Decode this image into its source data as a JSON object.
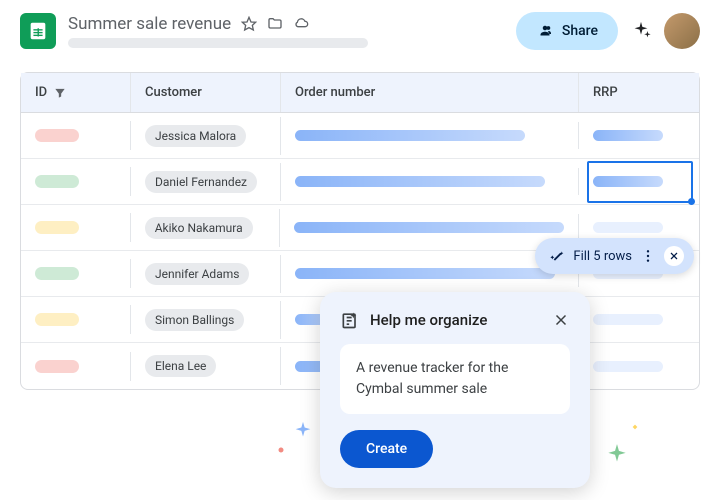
{
  "header": {
    "doc_title": "Summer sale revenue",
    "share_label": "Share"
  },
  "columns": {
    "id": "ID",
    "customer": "Customer",
    "order": "Order number",
    "rrp": "RRP"
  },
  "rows": [
    {
      "customer": "Jessica Malora",
      "id_color": "pill-red",
      "order_w": 230,
      "rrp_w": 70,
      "rrp_style": "blue"
    },
    {
      "customer": "Daniel Fernandez",
      "id_color": "pill-green",
      "order_w": 250,
      "rrp_w": 70,
      "rrp_style": "blue"
    },
    {
      "customer": "Akiko Nakamura",
      "id_color": "pill-yellow",
      "order_w": 270,
      "rrp_w": 70,
      "rrp_style": "light"
    },
    {
      "customer": "Jennifer Adams",
      "id_color": "pill-green",
      "order_w": 260,
      "rrp_w": 70,
      "rrp_style": "light"
    },
    {
      "customer": "Simon Ballings",
      "id_color": "pill-yellow",
      "order_w": 40,
      "rrp_w": 70,
      "rrp_style": "light"
    },
    {
      "customer": "Elena Lee",
      "id_color": "pill-red",
      "order_w": 110,
      "rrp_w": 70,
      "rrp_style": "light"
    }
  ],
  "fill_chip": {
    "label": "Fill 5 rows"
  },
  "organize": {
    "title": "Help me organize",
    "prompt": "A revenue tracker for the Cymbal summer sale",
    "create_label": "Create"
  },
  "colors": {
    "accent": "#1a73e8",
    "share_bg": "#c2e7ff",
    "panel_bg": "#eef3fd"
  }
}
